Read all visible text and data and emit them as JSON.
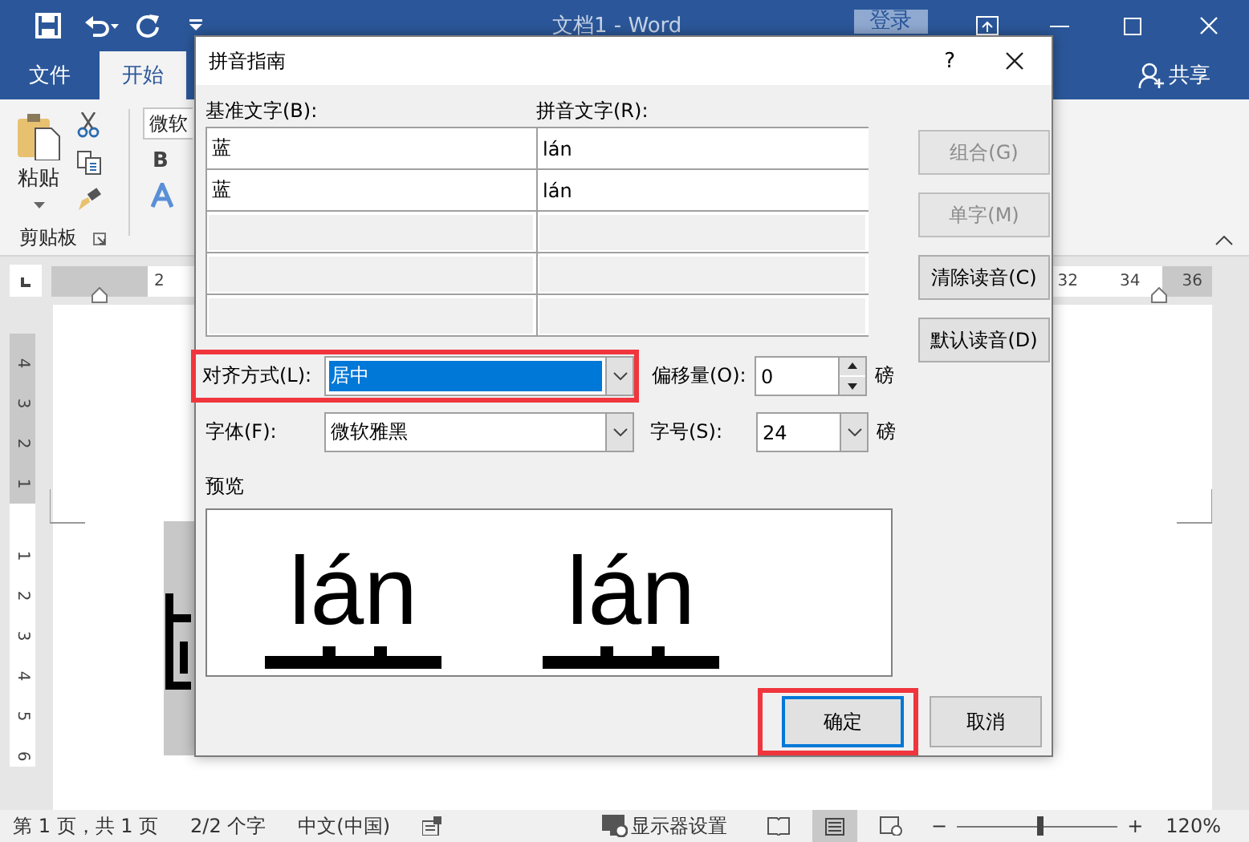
{
  "title_bar": {
    "title": "文档1 - Word",
    "login_button": "登录"
  },
  "ribbon_tabs": [
    {
      "label": "文件",
      "selected": false
    },
    {
      "label": "开始",
      "selected": true
    }
  ],
  "share_button": "共享",
  "clipboard": {
    "paste": "粘贴",
    "group_label": "剪贴板"
  },
  "font_group": {
    "font_name": "微软",
    "bold": "B"
  },
  "ruler": {
    "left_labels": [
      "2"
    ],
    "right_labels": [
      "32",
      "34",
      "36"
    ]
  },
  "vertical_ruler": {
    "upper": [
      "4",
      "3",
      "2",
      "1"
    ],
    "lower": [
      "1",
      "2",
      "3",
      "4",
      "5",
      "6"
    ]
  },
  "dialog": {
    "title": "拼音指南",
    "help_button": "?",
    "base_label": "基准文字(B):",
    "ruby_label": "拼音文字(R):",
    "rows": [
      {
        "base": "蓝",
        "ruby": "lán",
        "disabled": false
      },
      {
        "base": "蓝",
        "ruby": "lán",
        "disabled": false
      },
      {
        "disabled": true
      },
      {
        "disabled": true
      },
      {
        "disabled": true
      }
    ],
    "side_buttons": [
      {
        "label": "组合(G)",
        "disabled": true
      },
      {
        "label": "单字(M)",
        "disabled": true
      },
      {
        "label": "清除读音(C)",
        "disabled": false
      },
      {
        "label": "默认读音(D)",
        "disabled": false
      }
    ],
    "alignment": {
      "label": "对齐方式(L):",
      "value": "居中",
      "focused": true,
      "highlighted": true
    },
    "offset": {
      "label": "偏移量(O):",
      "value": "0",
      "unit": "磅"
    },
    "font": {
      "label": "字体(F):",
      "value": "微软雅黑"
    },
    "size": {
      "label": "字号(S):",
      "value": "24",
      "unit": "磅"
    },
    "preview": {
      "label": "预览",
      "items": [
        {
          "ruby": "lán"
        },
        {
          "ruby": "lán"
        }
      ]
    },
    "buttons": [
      {
        "label": "确定",
        "default": true,
        "highlighted": true
      },
      {
        "label": "取消",
        "default": false,
        "highlighted": false
      }
    ]
  },
  "status_bar": {
    "page": "第 1 页，共 1 页",
    "words": "2/2 个字",
    "language": "中文(中国)",
    "display_settings": "显示器设置",
    "zoom_minus": "−",
    "zoom_slider": {
      "level": 0.52
    },
    "zoom_plus": "+",
    "zoom": "120%"
  }
}
